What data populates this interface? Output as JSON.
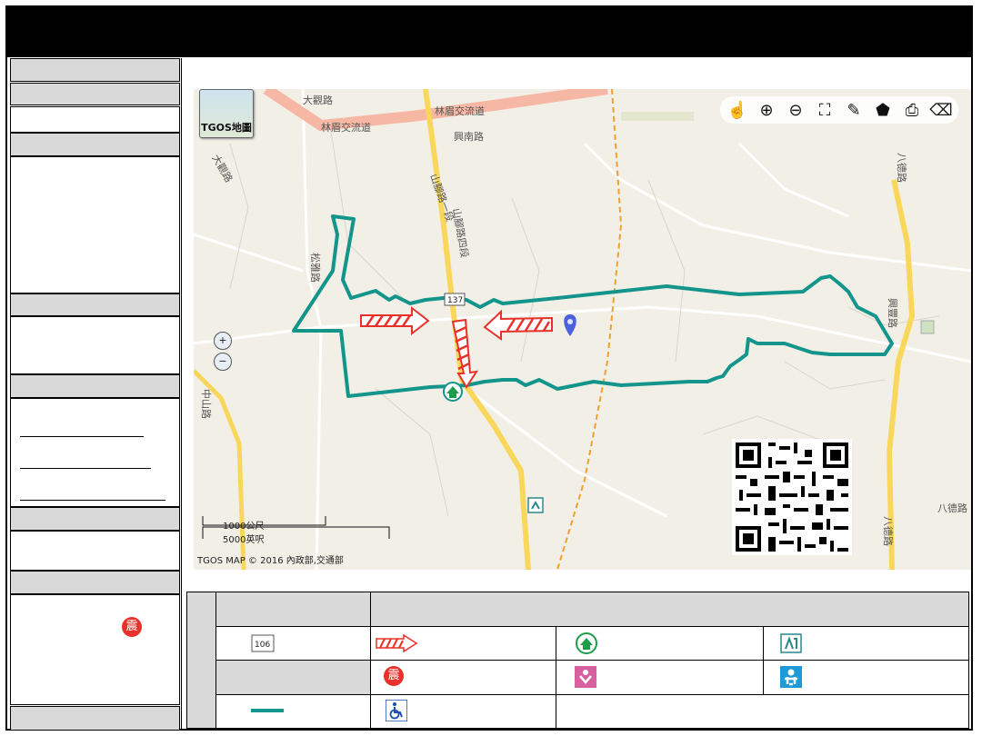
{
  "map": {
    "logo_label": "TGOS地圖",
    "roads": [
      "大觀路",
      "林眉交流道",
      "林眉交流道",
      "興南路",
      "山腳路一段",
      "山腳路四段",
      "松雅路",
      "大觀路",
      "中山路",
      "八德路",
      "八德路",
      "興豐路",
      "八德路"
    ],
    "route_shield": "137",
    "scale": {
      "metric": "1000公尺",
      "imperial": "5000英呎"
    },
    "credit": "TGOS MAP © 2016 內政部,交通部",
    "tools": [
      "pan-icon",
      "zoom-in-icon",
      "zoom-out-icon",
      "full-extent-icon",
      "draw-line-icon",
      "draw-area-icon",
      "print-icon",
      "eraser-icon"
    ],
    "colors": {
      "boundary": "#13958c",
      "arrow": "#e8312a",
      "highway": "#f6b7a4",
      "provincial": "#f9d75b",
      "marker": "#4b62e0"
    }
  },
  "legend": {
    "route_icon_text": "106",
    "quake_icon_text": "震"
  },
  "sidebar": {
    "quake_badge": "震"
  }
}
